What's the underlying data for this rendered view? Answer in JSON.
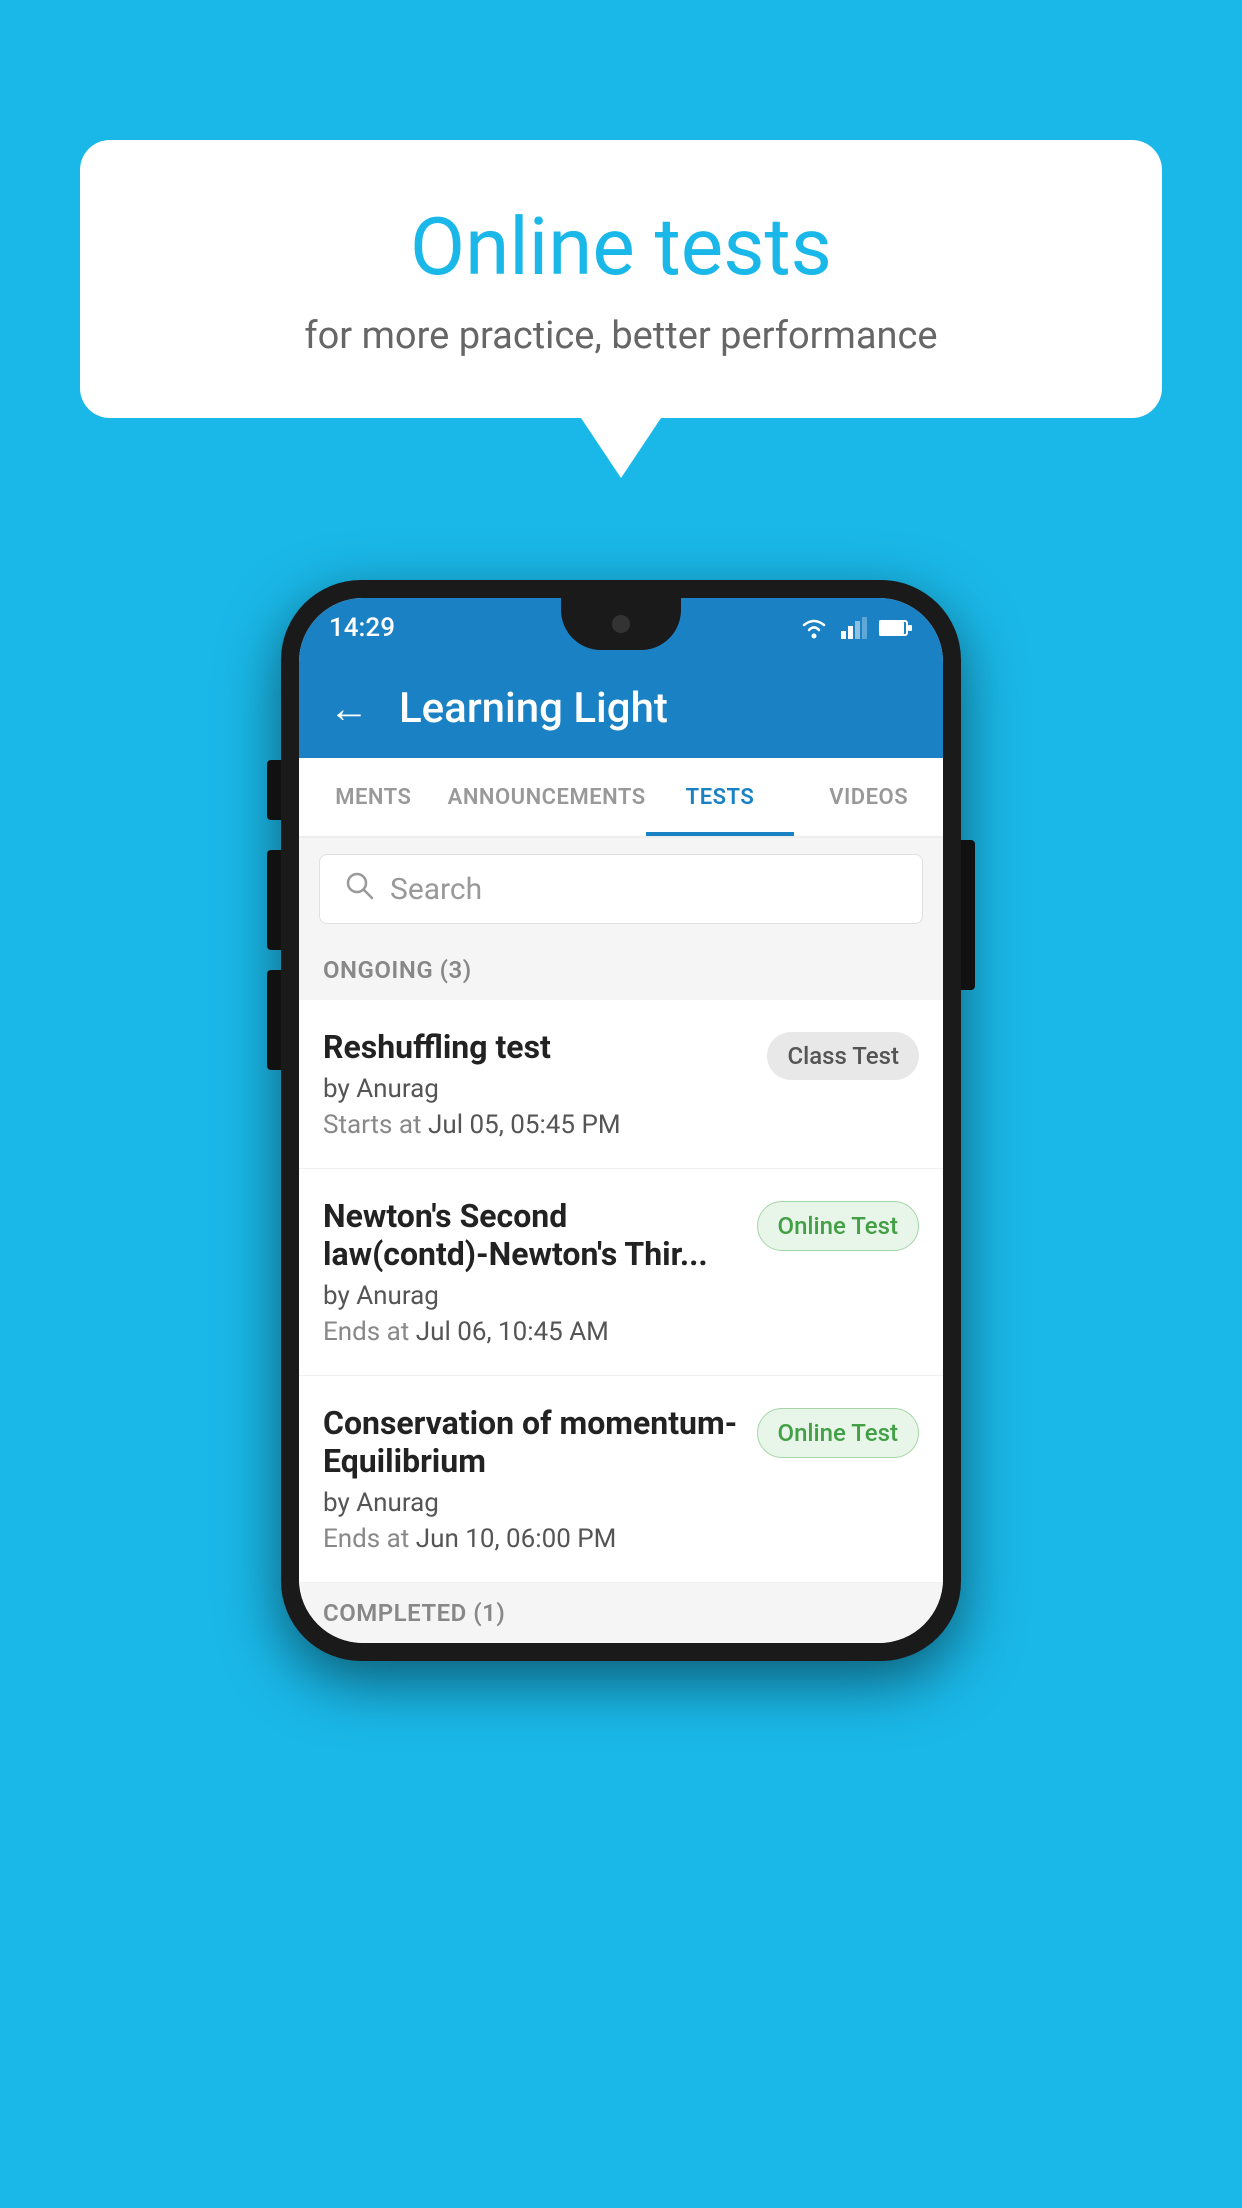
{
  "background_color": "#1ab8e8",
  "speech_bubble": {
    "title": "Online tests",
    "subtitle": "for more practice, better performance"
  },
  "phone": {
    "status_bar": {
      "time": "14:29"
    },
    "app_bar": {
      "back_icon": "←",
      "title": "Learning Light"
    },
    "tabs": [
      {
        "label": "MENTS",
        "active": false
      },
      {
        "label": "ANNOUNCEMENTS",
        "active": false
      },
      {
        "label": "TESTS",
        "active": true
      },
      {
        "label": "VIDEOS",
        "active": false
      }
    ],
    "search": {
      "placeholder": "Search"
    },
    "ongoing_section": {
      "label": "ONGOING (3)"
    },
    "test_items": [
      {
        "title": "Reshuffling test",
        "author": "by Anurag",
        "time_label": "Starts at",
        "time_value": "Jul 05, 05:45 PM",
        "badge": "Class Test",
        "badge_type": "class"
      },
      {
        "title": "Newton's Second law(contd)-Newton's Thir...",
        "author": "by Anurag",
        "time_label": "Ends at",
        "time_value": "Jul 06, 10:45 AM",
        "badge": "Online Test",
        "badge_type": "online"
      },
      {
        "title": "Conservation of momentum-Equilibrium",
        "author": "by Anurag",
        "time_label": "Ends at",
        "time_value": "Jun 10, 06:00 PM",
        "badge": "Online Test",
        "badge_type": "online"
      }
    ],
    "completed_section": {
      "label": "COMPLETED (1)"
    }
  }
}
